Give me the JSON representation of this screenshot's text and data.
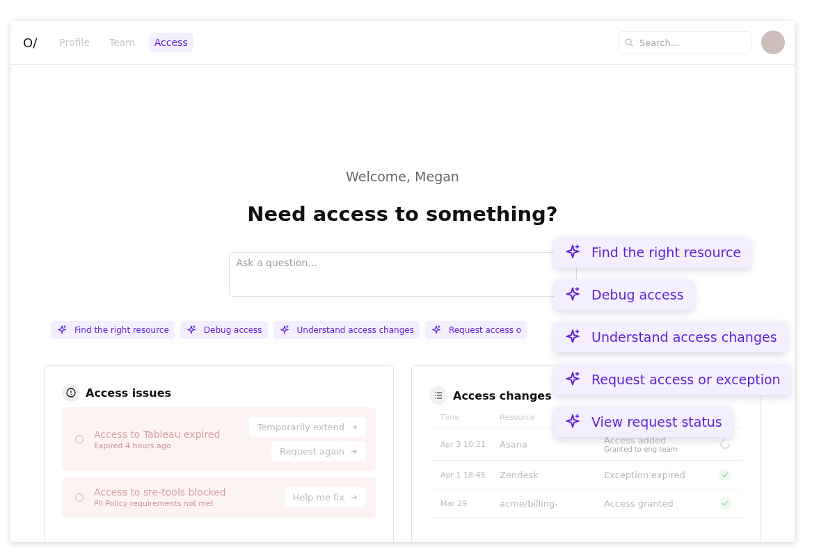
{
  "nav": {
    "logo": "O/",
    "tabs": [
      {
        "label": "Profile",
        "selected": false
      },
      {
        "label": "Team",
        "selected": false
      },
      {
        "label": "Access",
        "selected": true
      }
    ],
    "search": {
      "placeholder": "Search..."
    }
  },
  "hero": {
    "greeting": "Welcome, Megan",
    "heading": "Need access to something?",
    "ask": {
      "placeholder": "Ask a question..."
    },
    "chips": [
      "Find the right resource",
      "Debug access",
      "Understand access changes",
      "Request access o"
    ]
  },
  "issues": {
    "title": "Access issues",
    "items": [
      {
        "title": "Access to Tableau expired",
        "detail": "Expired 4 hours ago",
        "actions": [
          "Temporarily extend",
          "Request again"
        ]
      },
      {
        "title": "Access to sre-tools blocked",
        "detail": "PII Policy requirements not met",
        "actions": [
          "Help me fix"
        ]
      }
    ]
  },
  "changes": {
    "title": "Access changes",
    "columns": [
      "Time",
      "Resource"
    ],
    "rows": [
      {
        "time": "Apr 3 10:21",
        "resource": "Asana",
        "change": "Access added",
        "detail": "Granted to eng-team",
        "kind": "pending"
      },
      {
        "time": "Apr 1 18:45",
        "resource": "Zendesk",
        "change": "Exception expired",
        "kind": "done"
      },
      {
        "time": "Mar 29",
        "resource": "acme/billing-",
        "change": "Access granted",
        "kind": "done"
      }
    ]
  },
  "suggestions": [
    "Find the right resource",
    "Debug access",
    "Understand access changes",
    "Request access or exception",
    "View request status"
  ]
}
